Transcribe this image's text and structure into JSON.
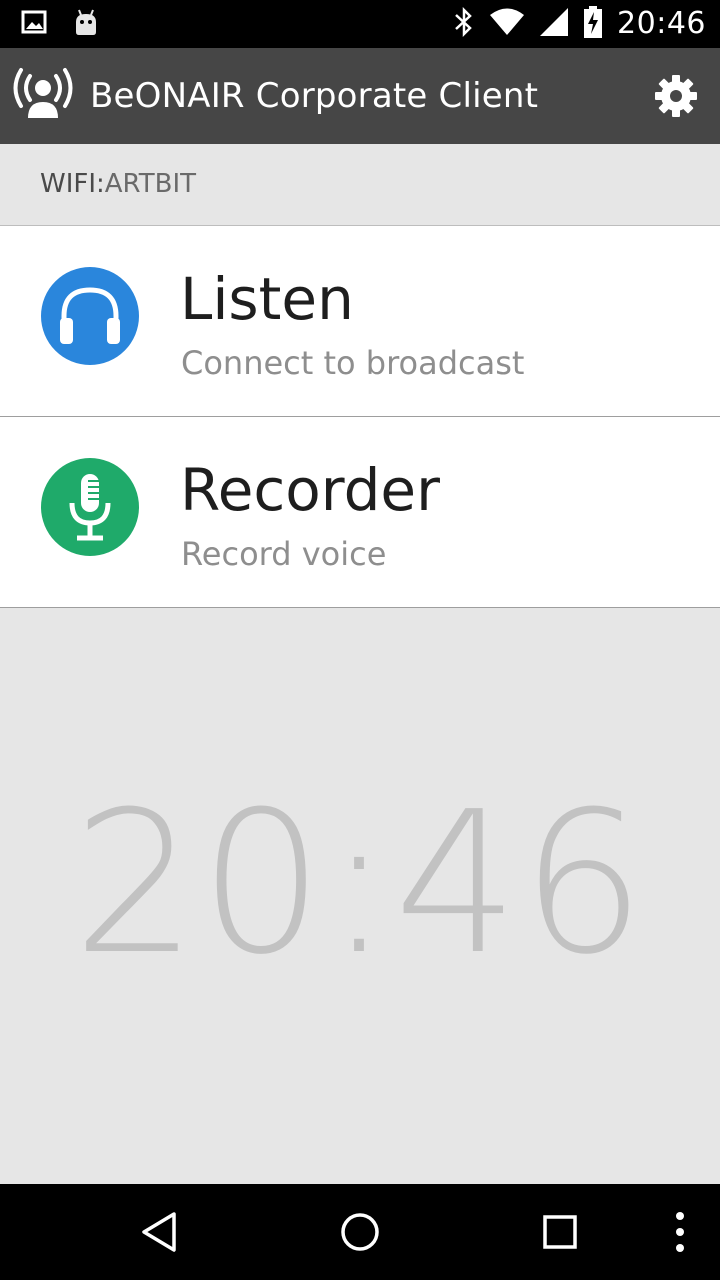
{
  "status_bar": {
    "time": "20:46",
    "icons": [
      "image-icon",
      "android-icon",
      "bluetooth-icon",
      "wifi-icon",
      "signal-icon",
      "battery-charging-icon"
    ]
  },
  "app_bar": {
    "title": "BeONAIR Corporate Client",
    "logo_icon": "broadcast-person-icon",
    "settings_icon": "gear-icon"
  },
  "wifi": {
    "label": "WIFI:",
    "value": "ARTBIT"
  },
  "menu": [
    {
      "title": "Listen",
      "subtitle": "Connect to broadcast",
      "icon": "headphones-icon",
      "color": "#2a86dc"
    },
    {
      "title": "Recorder",
      "subtitle": "Record voice",
      "icon": "microphone-icon",
      "color": "#1faa6a"
    }
  ],
  "clock": {
    "time": "20:46"
  },
  "nav_bar": {
    "icons": [
      "back-icon",
      "home-icon",
      "recents-icon",
      "overflow-icon"
    ]
  }
}
